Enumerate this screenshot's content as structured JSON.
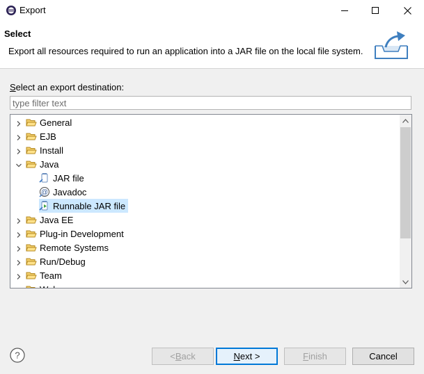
{
  "window": {
    "title": "Export",
    "icon": "eclipse-icon"
  },
  "header": {
    "title": "Select",
    "description": "Export all resources required to run an application into a JAR file on the local file system.",
    "image": "export-wizard-banner-icon"
  },
  "destination": {
    "label_prefix": "",
    "label_mnemonic": "S",
    "label_rest": "elect an export destination:",
    "filter_placeholder": "type filter text",
    "filter_value": ""
  },
  "tree": {
    "items": [
      {
        "label": "General",
        "level": 0,
        "type": "folder",
        "expanded": false
      },
      {
        "label": "EJB",
        "level": 0,
        "type": "folder",
        "expanded": false
      },
      {
        "label": "Install",
        "level": 0,
        "type": "folder",
        "expanded": false
      },
      {
        "label": "Java",
        "level": 0,
        "type": "folder",
        "expanded": true
      },
      {
        "label": "JAR file",
        "level": 1,
        "type": "jar"
      },
      {
        "label": "Javadoc",
        "level": 1,
        "type": "javadoc"
      },
      {
        "label": "Runnable JAR file",
        "level": 1,
        "type": "runnable-jar",
        "selected": true
      },
      {
        "label": "Java EE",
        "level": 0,
        "type": "folder",
        "expanded": false
      },
      {
        "label": "Plug-in Development",
        "level": 0,
        "type": "folder",
        "expanded": false
      },
      {
        "label": "Remote Systems",
        "level": 0,
        "type": "folder",
        "expanded": false
      },
      {
        "label": "Run/Debug",
        "level": 0,
        "type": "folder",
        "expanded": false
      },
      {
        "label": "Team",
        "level": 0,
        "type": "folder",
        "expanded": false
      },
      {
        "label": "Web",
        "level": 0,
        "type": "folder",
        "expanded": false
      }
    ]
  },
  "buttons": {
    "back_mn": "B",
    "back_pre": "< ",
    "back_post": "ack",
    "next_mn": "N",
    "next_pre": "",
    "next_post": "ext >",
    "finish_mn": "F",
    "finish_pre": "",
    "finish_post": "inish",
    "cancel": "Cancel"
  },
  "colors": {
    "selection": "#cce8ff",
    "folder": "#e8b64a",
    "accent": "#0078d7"
  }
}
